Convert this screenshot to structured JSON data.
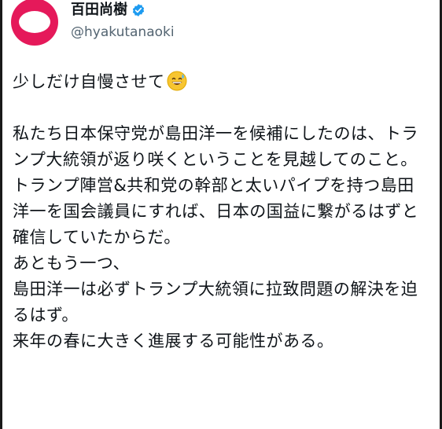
{
  "author": {
    "display_name": "百田尚樹",
    "handle": "@hyakutanaoki",
    "verified_icon": "verified-badge-icon",
    "avatar_icon": "avatar-logo"
  },
  "tweet": {
    "line1": "少しだけ自慢させて",
    "line1_emoji": "grinning-sweat-emoji",
    "para1": "私たち日本保守党が島田洋一を候補にしたのは、トランプ大統領が返り咲くということを見越してのこと。",
    "para2": "トランプ陣営&共和党の幹部と太いパイプを持つ島田洋一を国会議員にすれば、日本の国益に繋がるはずと確信していたからだ。",
    "para3": "あともう一つ、",
    "para4": "島田洋一は必ずトランプ大統領に拉致問題の解決を迫るはず。",
    "para5": "来年の春に大きく進展する可能性がある。"
  },
  "colors": {
    "text": "#0f1419",
    "handle": "#536471",
    "verified": "#1d9bf0",
    "avatar": "#e5195a"
  }
}
